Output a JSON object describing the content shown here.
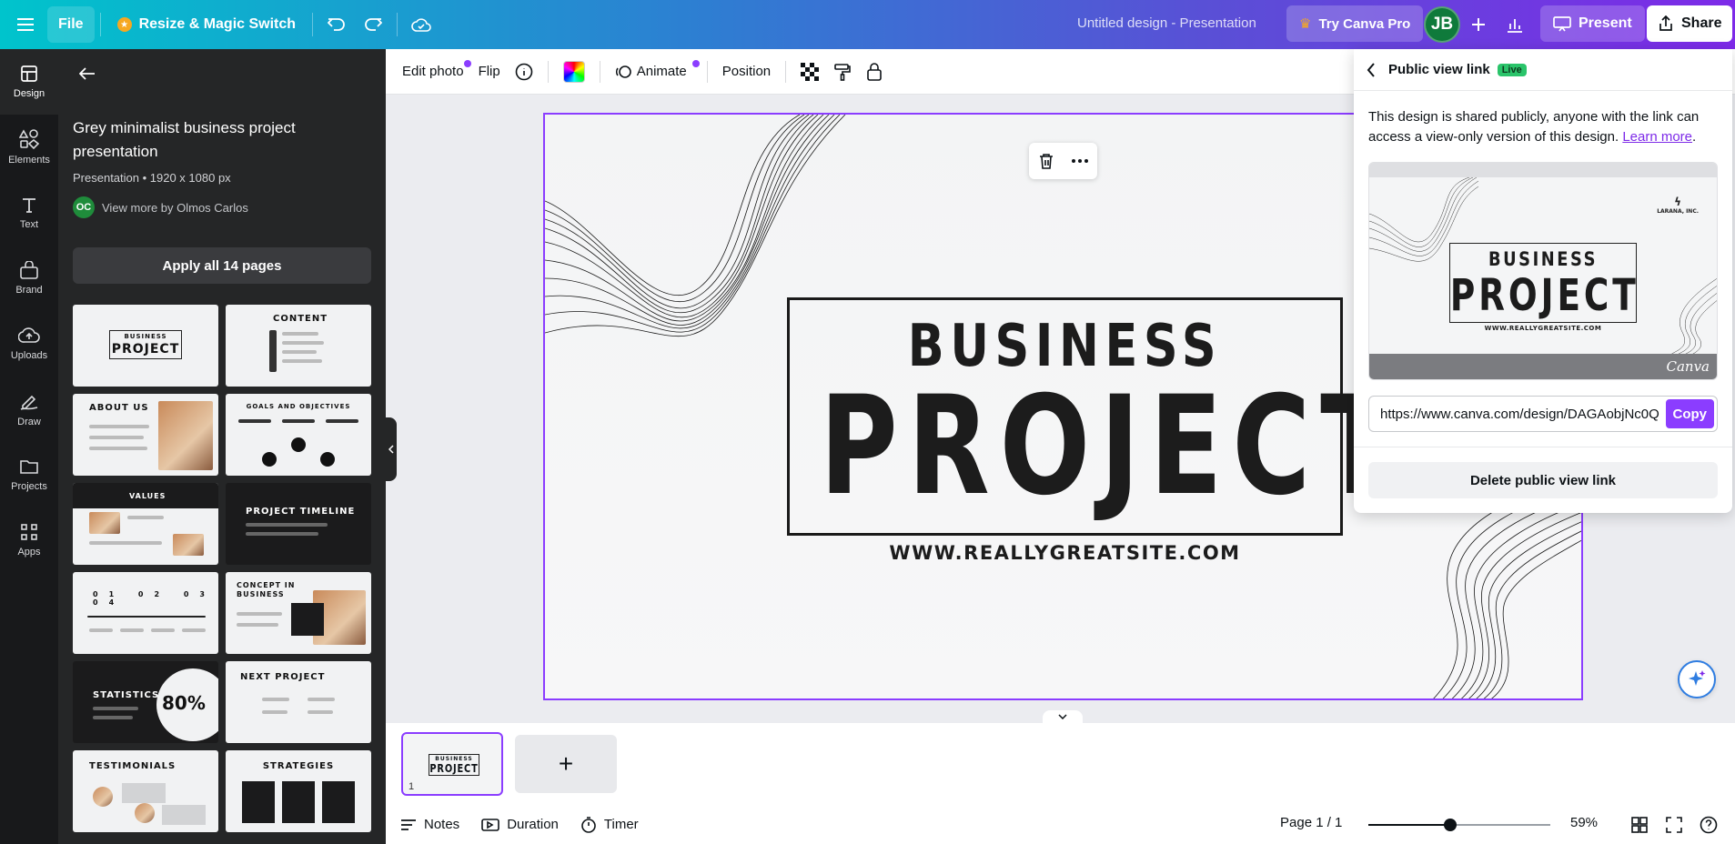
{
  "topbar": {
    "menu_icon": "hamburger-icon",
    "file_label": "File",
    "resize_label": "Resize & Magic Switch",
    "design_title": "Untitled design - Presentation",
    "pro_label": "Try Canva Pro",
    "avatar_initials": "JB",
    "present_label": "Present",
    "share_label": "Share",
    "accent_crown": "#f6a821"
  },
  "rail": {
    "items": [
      {
        "label": "Design",
        "icon": "layout-icon"
      },
      {
        "label": "Elements",
        "icon": "shapes-icon"
      },
      {
        "label": "Text",
        "icon": "text-icon"
      },
      {
        "label": "Brand",
        "icon": "brand-icon"
      },
      {
        "label": "Uploads",
        "icon": "cloud-upload-icon"
      },
      {
        "label": "Draw",
        "icon": "pen-icon"
      },
      {
        "label": "Projects",
        "icon": "folder-icon"
      },
      {
        "label": "Apps",
        "icon": "apps-grid-icon"
      }
    ]
  },
  "panel": {
    "title": "Grey minimalist business project presentation",
    "meta": "Presentation • 1920 x 1080 px",
    "author_initials": "OC",
    "author_link": "View more by Olmos Carlos",
    "apply_label": "Apply all 14 pages",
    "thumbs": [
      {
        "title": "BUSINESS",
        "sub": "PROJECT",
        "theme": "light"
      },
      {
        "title": "CONTENT",
        "theme": "light"
      },
      {
        "title": "ABOUT US",
        "theme": "light"
      },
      {
        "title": "GOALS AND OBJECTIVES",
        "theme": "light"
      },
      {
        "title": "VALUES",
        "theme": "dark"
      },
      {
        "title": "PROJECT TIMELINE",
        "theme": "dark"
      },
      {
        "title": "01  02  03  04",
        "theme": "light"
      },
      {
        "title": "CONCEPT IN BUSINESS",
        "theme": "light"
      },
      {
        "title": "STATISTICS",
        "sub": "80%",
        "theme": "dark"
      },
      {
        "title": "NEXT PROJECT",
        "theme": "light"
      },
      {
        "title": "TESTIMONIALS",
        "theme": "light"
      },
      {
        "title": "STRATEGIES",
        "theme": "dark"
      }
    ]
  },
  "ctx_toolbar": {
    "edit_photo": "Edit photo",
    "flip": "Flip",
    "animate": "Animate",
    "position": "Position"
  },
  "slide": {
    "business": "BUSINESS",
    "project": "PROJECT",
    "url": "WWW.REALLYGREATSITE.COM"
  },
  "share_popover": {
    "title": "Public view link",
    "badge": "Live",
    "description": "This design is shared publicly, anyone with the link can access a view-only version of this design.",
    "learn_more": "Learn more",
    "preview_logo": "LARANA, INC.",
    "preview_brand": "Canva",
    "link_value": "https://www.canva.com/design/DAGAobjNc0Q",
    "copy_label": "Copy",
    "delete_label": "Delete public view link"
  },
  "pages": {
    "page_number": "1",
    "add_symbol": "+"
  },
  "footer": {
    "notes": "Notes",
    "duration": "Duration",
    "timer": "Timer",
    "page_indicator": "Page 1 / 1",
    "zoom_label": "59%",
    "zoom_fraction": 0.45
  }
}
